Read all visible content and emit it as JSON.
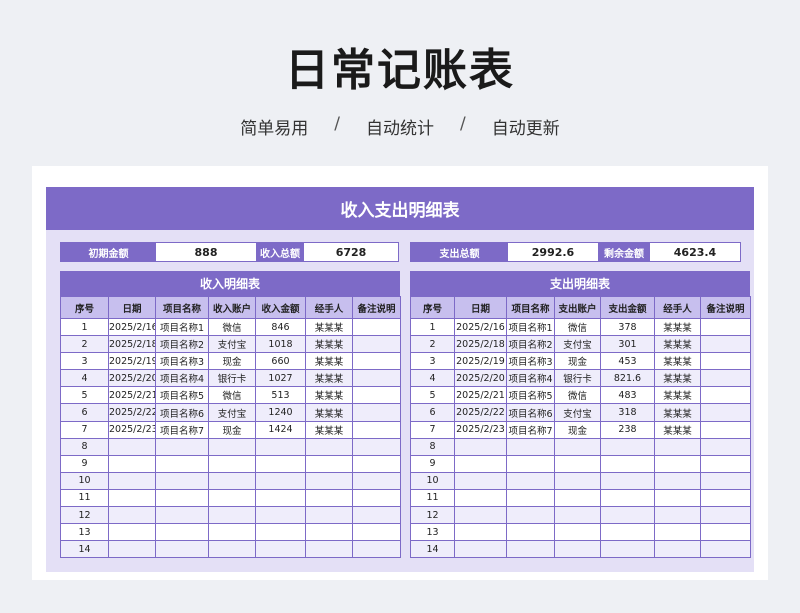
{
  "header": {
    "title": "日常记账表",
    "tags": [
      "简单易用",
      "自动统计",
      "自动更新"
    ],
    "separator": "/"
  },
  "sheet": {
    "banner": "收入支出明细表",
    "summary": {
      "initial_label": "初期金额",
      "initial_value": "888",
      "income_total_label": "收入总额",
      "income_total_value": "6728",
      "expense_total_label": "支出总额",
      "expense_total_value": "2992.6",
      "balance_label": "剩余金额",
      "balance_value": "4623.4"
    },
    "income": {
      "title": "收入明细表",
      "columns": [
        "序号",
        "日期",
        "项目名称",
        "收入账户",
        "收入金额",
        "经手人",
        "备注说明"
      ],
      "rows": [
        [
          "1",
          "2025/2/16",
          "项目名称1",
          "微信",
          "846",
          "某某某",
          ""
        ],
        [
          "2",
          "2025/2/18",
          "项目名称2",
          "支付宝",
          "1018",
          "某某某",
          ""
        ],
        [
          "3",
          "2025/2/19",
          "项目名称3",
          "现金",
          "660",
          "某某某",
          ""
        ],
        [
          "4",
          "2025/2/20",
          "项目名称4",
          "银行卡",
          "1027",
          "某某某",
          ""
        ],
        [
          "5",
          "2025/2/21",
          "项目名称5",
          "微信",
          "513",
          "某某某",
          ""
        ],
        [
          "6",
          "2025/2/22",
          "项目名称6",
          "支付宝",
          "1240",
          "某某某",
          ""
        ],
        [
          "7",
          "2025/2/23",
          "项目名称7",
          "现金",
          "1424",
          "某某某",
          ""
        ],
        [
          "8",
          "",
          "",
          "",
          "",
          "",
          ""
        ],
        [
          "9",
          "",
          "",
          "",
          "",
          "",
          ""
        ],
        [
          "10",
          "",
          "",
          "",
          "",
          "",
          ""
        ],
        [
          "11",
          "",
          "",
          "",
          "",
          "",
          ""
        ],
        [
          "12",
          "",
          "",
          "",
          "",
          "",
          ""
        ],
        [
          "13",
          "",
          "",
          "",
          "",
          "",
          ""
        ],
        [
          "14",
          "",
          "",
          "",
          "",
          "",
          ""
        ]
      ]
    },
    "expense": {
      "title": "支出明细表",
      "columns": [
        "序号",
        "日期",
        "项目名称",
        "支出账户",
        "支出金额",
        "经手人",
        "备注说明"
      ],
      "rows": [
        [
          "1",
          "2025/2/16",
          "项目名称1",
          "微信",
          "378",
          "某某某",
          ""
        ],
        [
          "2",
          "2025/2/18",
          "项目名称2",
          "支付宝",
          "301",
          "某某某",
          ""
        ],
        [
          "3",
          "2025/2/19",
          "项目名称3",
          "现金",
          "453",
          "某某某",
          ""
        ],
        [
          "4",
          "2025/2/20",
          "项目名称4",
          "银行卡",
          "821.6",
          "某某某",
          ""
        ],
        [
          "5",
          "2025/2/21",
          "项目名称5",
          "微信",
          "483",
          "某某某",
          ""
        ],
        [
          "6",
          "2025/2/22",
          "项目名称6",
          "支付宝",
          "318",
          "某某某",
          ""
        ],
        [
          "7",
          "2025/2/23",
          "项目名称7",
          "现金",
          "238",
          "某某某",
          ""
        ],
        [
          "8",
          "",
          "",
          "",
          "",
          "",
          ""
        ],
        [
          "9",
          "",
          "",
          "",
          "",
          "",
          ""
        ],
        [
          "10",
          "",
          "",
          "",
          "",
          "",
          ""
        ],
        [
          "11",
          "",
          "",
          "",
          "",
          "",
          ""
        ],
        [
          "12",
          "",
          "",
          "",
          "",
          "",
          ""
        ],
        [
          "13",
          "",
          "",
          "",
          "",
          "",
          ""
        ],
        [
          "14",
          "",
          "",
          "",
          "",
          "",
          ""
        ]
      ]
    }
  },
  "colors": {
    "accent": "#7d6ac7",
    "header_cell": "#c7bfee",
    "alt_row": "#efedfb",
    "panel_bg": "#e4e0f6"
  }
}
